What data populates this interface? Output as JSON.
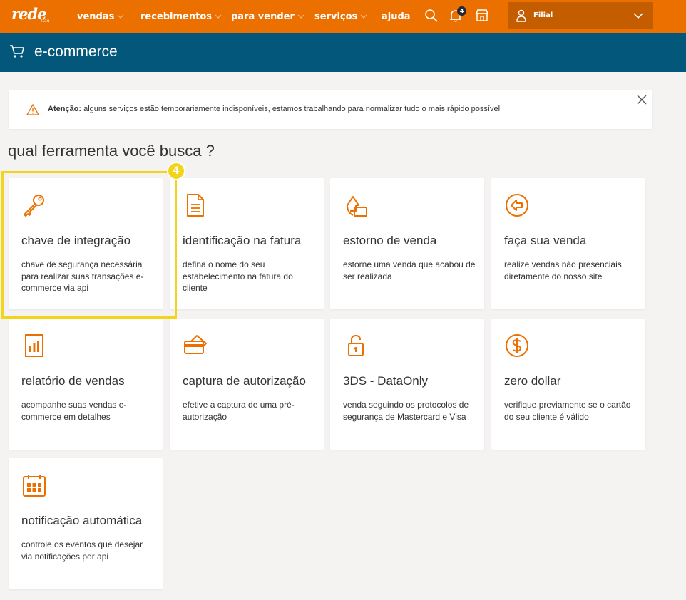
{
  "brand": {
    "name": "rede",
    "sub": "itaú"
  },
  "nav": {
    "items": [
      {
        "label": "vendas",
        "has_dropdown": true
      },
      {
        "label": "recebimentos",
        "has_dropdown": true
      },
      {
        "label": "para vender",
        "has_dropdown": true
      },
      {
        "label": "serviços",
        "has_dropdown": true
      },
      {
        "label": "ajuda",
        "has_dropdown": false
      }
    ],
    "notification_count": "4",
    "store_selector": "Filial"
  },
  "page": {
    "title": "e-commerce"
  },
  "alert": {
    "strong": "Atenção:",
    "message": " alguns serviços estão temporariamente indisponíveis, estamos trabalhando para normalizar tudo o mais rápido possível"
  },
  "heading": "qual ferramenta você busca ?",
  "tools": [
    {
      "icon": "key-icon",
      "title": "chave de integração",
      "description": "chave de segurança necessária para realizar suas transações e-commerce via api"
    },
    {
      "icon": "document-icon",
      "title": "identificação na fatura",
      "description": "defina o nome do seu estabelecimento na fatura do cliente"
    },
    {
      "icon": "refund-icon",
      "title": "estorno de venda",
      "description": "estorne uma venda que acabou de ser realizada"
    },
    {
      "icon": "arrow-left-circle-icon",
      "title": "faça sua venda",
      "description": "realize vendas não presenciais diretamente do nosso site"
    },
    {
      "icon": "report-chart-icon",
      "title": "relatório de vendas",
      "description": "acompanhe suas vendas e-commerce em detalhes"
    },
    {
      "icon": "card-capture-icon",
      "title": "captura de autorização",
      "description": "efetive a captura de uma pré-autorização"
    },
    {
      "icon": "lock-icon",
      "title": "3DS - DataOnly",
      "description": "venda seguindo os protocolos de segurança de Mastercard e Visa"
    },
    {
      "icon": "dollar-circle-icon",
      "title": "zero dollar",
      "description": "verifique previamente se o cartão do seu cliente é válido"
    },
    {
      "icon": "calendar-icon",
      "title": "notificação automática",
      "description": "controle os eventos que desejar via notificações por api"
    }
  ],
  "tutorial_step": "4",
  "colors": {
    "brand_orange": "#ec7000",
    "header_blue": "#03577a",
    "highlight_yellow": "#f2d41a"
  }
}
